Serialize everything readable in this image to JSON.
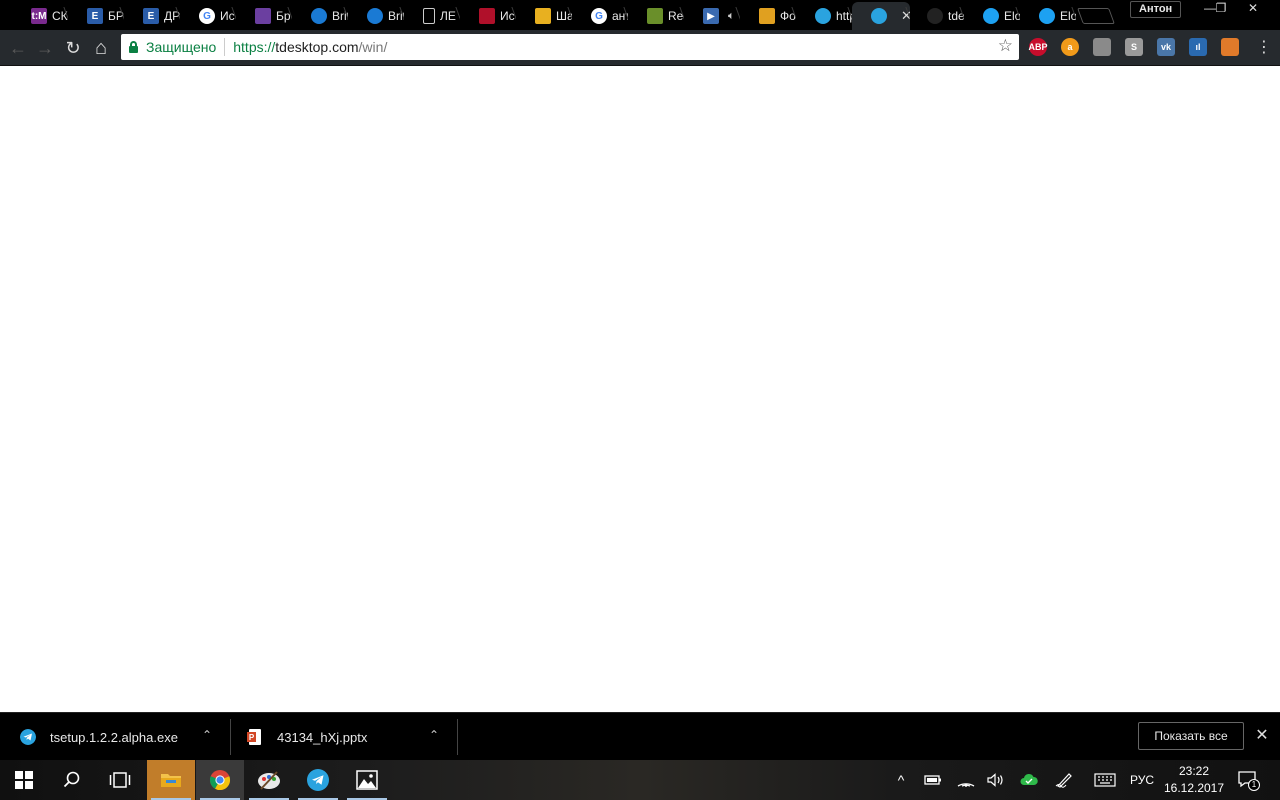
{
  "browser": {
    "tabs": [
      {
        "label": "СК",
        "icon": "tm-icon",
        "color": "#7a2a8e",
        "glyph": "t:M"
      },
      {
        "label": "БРІ",
        "icon": "document-e-icon",
        "color": "#2a5ca8",
        "glyph": "Е"
      },
      {
        "label": "ДР",
        "icon": "document-e-icon",
        "color": "#2a5ca8",
        "glyph": "Е"
      },
      {
        "label": "Ис",
        "icon": "google-icon",
        "color": "#ffffff",
        "glyph": "G"
      },
      {
        "label": "Бр",
        "icon": "person-icon",
        "color": "#6b3fa0",
        "glyph": ""
      },
      {
        "label": "Brit",
        "icon": "edge-icon",
        "color": "#1a7ad4",
        "glyph": ""
      },
      {
        "label": "Brit",
        "icon": "edge-icon",
        "color": "#1a7ad4",
        "glyph": ""
      },
      {
        "label": "ЛЕ",
        "icon": "blank-page-icon",
        "color": "#000000",
        "glyph": ""
      },
      {
        "label": "Ис",
        "icon": "trophy-icon",
        "color": "#b0102a",
        "glyph": ""
      },
      {
        "label": "Ша",
        "icon": "puzzle-icon",
        "color": "#e8b020",
        "glyph": ""
      },
      {
        "label": "ант",
        "icon": "google-icon",
        "color": "#ffffff",
        "glyph": "G"
      },
      {
        "label": "Rec",
        "icon": "android-icon",
        "color": "#6a8f2a",
        "glyph": ""
      },
      {
        "label": "",
        "icon": "media-play-icon",
        "color": "#3a6ab0",
        "glyph": "▶",
        "audio": true
      },
      {
        "label": "Фо",
        "icon": "photos-pinwheel-icon",
        "color": "#e0a020",
        "glyph": ""
      },
      {
        "label": "http",
        "icon": "telegram-icon",
        "color": "#2aa3df",
        "glyph": ""
      },
      {
        "label": "",
        "icon": "telegram-icon",
        "color": "#2aa3df",
        "glyph": "",
        "active": true
      },
      {
        "label": "tde",
        "icon": "github-icon",
        "color": "#222222",
        "glyph": ""
      },
      {
        "label": "Elo",
        "icon": "twitter-icon",
        "color": "#1da1f2",
        "glyph": ""
      },
      {
        "label": "Elo",
        "icon": "twitter-icon",
        "color": "#1da1f2",
        "glyph": ""
      }
    ],
    "profile_name": "Антон",
    "controls": {
      "minimize": "—",
      "restore": "❐",
      "close": "✕"
    },
    "nav": {
      "back": "←",
      "forward": "→",
      "reload": "↻",
      "home": "⌂"
    },
    "omnibox": {
      "secure_label": "Защищено",
      "url_scheme": "https://",
      "url_host": "tdesktop.com",
      "url_path": "/win/",
      "star": "☆"
    },
    "extensions": [
      {
        "name": "adblock-plus-icon",
        "text": "ABP",
        "color": "#c70d2c"
      },
      {
        "name": "orange-extension-icon",
        "text": "a",
        "color": "#f19a1a"
      },
      {
        "name": "bulb-extension-icon",
        "text": "",
        "color": "#8a8a8a"
      },
      {
        "name": "s-extension-icon",
        "text": "S",
        "color": "#9a9a9a"
      },
      {
        "name": "vk-icon",
        "text": "vk",
        "color": "#4a76a8"
      },
      {
        "name": "stats-extension-icon",
        "text": "ıl",
        "color": "#2a6ab0"
      },
      {
        "name": "image-extension-icon",
        "text": "",
        "color": "#e07a2a"
      }
    ],
    "menu": "⋮"
  },
  "downloads": {
    "items": [
      {
        "filename": "tsetup.1.2.2.alpha.exe",
        "icon": "telegram-icon"
      },
      {
        "filename": "43134_hXj.pptx",
        "icon": "powerpoint-icon"
      }
    ],
    "show_all_label": "Показать все",
    "close": "✕"
  },
  "taskbar": {
    "apps": [
      {
        "name": "start-button",
        "glyph": "⊞"
      },
      {
        "name": "search-button",
        "glyph": "⚲"
      },
      {
        "name": "task-view-button",
        "glyph": "▭"
      },
      {
        "name": "file-explorer-button",
        "glyph": ""
      },
      {
        "name": "chrome-button",
        "glyph": ""
      },
      {
        "name": "paint-button",
        "glyph": ""
      },
      {
        "name": "telegram-button",
        "glyph": ""
      },
      {
        "name": "photos-button",
        "glyph": ""
      }
    ],
    "tray": {
      "chevron": "^",
      "language": "РУС",
      "time": "23:22",
      "date": "16.12.2017",
      "notifications": "1"
    }
  }
}
